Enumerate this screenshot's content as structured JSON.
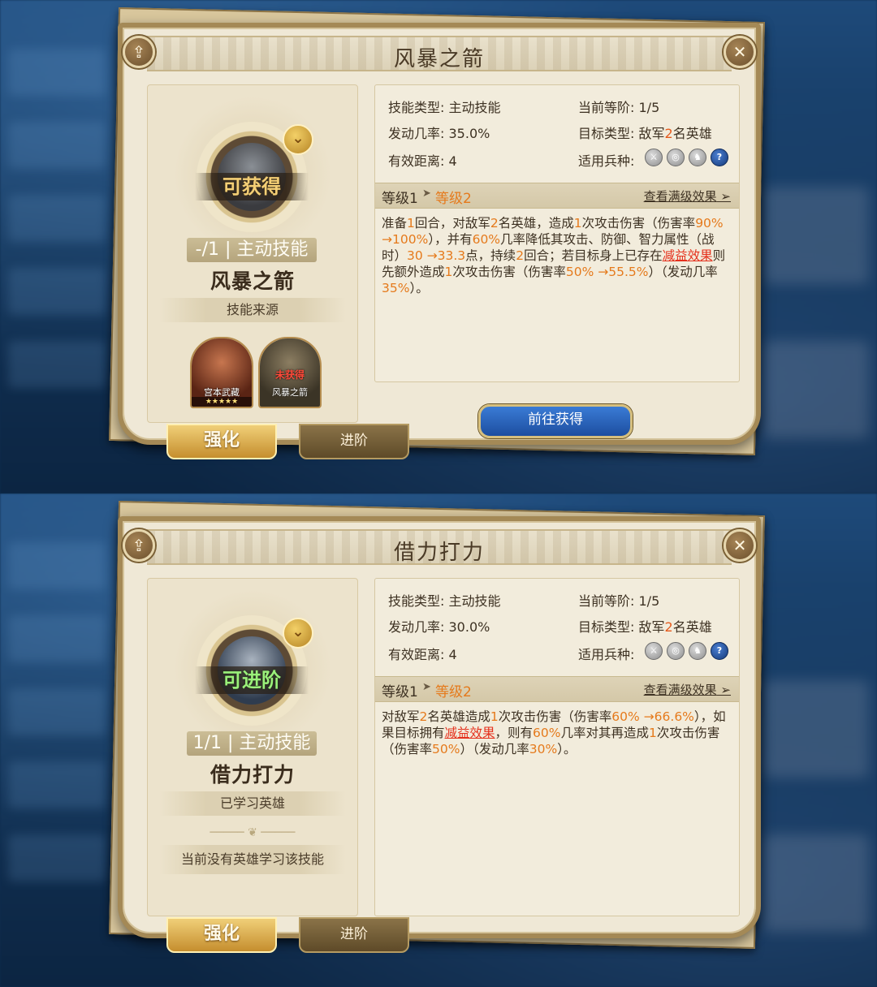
{
  "panels": [
    {
      "title": "风暴之箭",
      "skill_state": "可获得",
      "level_tag": "-/1 | 主动技能",
      "skill_name": "风暴之箭",
      "source_label": "技能来源",
      "heroes": [
        {
          "name": "宫本武藏",
          "stars": "★★★★★",
          "locked": ""
        },
        {
          "name": "风暴之箭",
          "stars": "",
          "locked": "未获得"
        }
      ],
      "stats": {
        "type_label": "技能类型:",
        "type_value": "主动技能",
        "rank_label": "当前等阶:",
        "rank_value": "1/5",
        "rate_label": "发动几率:",
        "rate_value": "35.0%",
        "target_label": "目标类型:",
        "target_pre": "敌军",
        "target_num": "2",
        "target_post": "名英雄",
        "range_label": "有效距离:",
        "range_value": "4",
        "troop_label": "适用兵种:"
      },
      "level_from": "等级1",
      "level_to": "等级2",
      "view_max": "查看满级效果",
      "desc_segments": [
        [
          "t",
          "准备"
        ],
        [
          "o",
          "1"
        ],
        [
          "t",
          "回合，对敌军"
        ],
        [
          "o",
          "2"
        ],
        [
          "t",
          "名英雄，造成"
        ],
        [
          "o",
          "1"
        ],
        [
          "t",
          "次攻击伤害（伤害率"
        ],
        [
          "o",
          "90% →100%"
        ],
        [
          "t",
          "），并有"
        ],
        [
          "o",
          "60%"
        ],
        [
          "t",
          "几率降低其攻击、防御、智力属性（战时）"
        ],
        [
          "o",
          "30 →33.3"
        ],
        [
          "t",
          "点，持续"
        ],
        [
          "o",
          "2"
        ],
        [
          "t",
          "回合；若目标身上已存在"
        ],
        [
          "r",
          "减益效果"
        ],
        [
          "t",
          "则先额外造成"
        ],
        [
          "o",
          "1"
        ],
        [
          "t",
          "次攻击伤害（伤害率"
        ],
        [
          "o",
          "50% →55.5%"
        ],
        [
          "t",
          "）（发动几率"
        ],
        [
          "o",
          "35%"
        ],
        [
          "t",
          "）。"
        ]
      ],
      "go_button": "前往获得",
      "tab_active": "强化",
      "tab_inactive": "进阶"
    },
    {
      "title": "借力打力",
      "skill_state": "可进阶",
      "level_tag": "1/1 | 主动技能",
      "skill_name": "借力打力",
      "source_label": "已学习英雄",
      "no_hero": "当前没有英雄学习该技能",
      "stats": {
        "type_label": "技能类型:",
        "type_value": "主动技能",
        "rank_label": "当前等阶:",
        "rank_value": "1/5",
        "rate_label": "发动几率:",
        "rate_value": "30.0%",
        "target_label": "目标类型:",
        "target_pre": "敌军",
        "target_num": "2",
        "target_post": "名英雄",
        "range_label": "有效距离:",
        "range_value": "4",
        "troop_label": "适用兵种:"
      },
      "level_from": "等级1",
      "level_to": "等级2",
      "view_max": "查看满级效果",
      "desc_segments": [
        [
          "t",
          "对敌军"
        ],
        [
          "o",
          "2"
        ],
        [
          "t",
          "名英雄造成"
        ],
        [
          "o",
          "1"
        ],
        [
          "t",
          "次攻击伤害（伤害率"
        ],
        [
          "o",
          "60% →66.6%"
        ],
        [
          "t",
          "），如果目标拥有"
        ],
        [
          "r",
          "减益效果"
        ],
        [
          "t",
          "，则有"
        ],
        [
          "o",
          "60%"
        ],
        [
          "t",
          "几率对其再造成"
        ],
        [
          "o",
          "1"
        ],
        [
          "t",
          "次攻击伤害（伤害率"
        ],
        [
          "o",
          "50%"
        ],
        [
          "t",
          "）（发动几率"
        ],
        [
          "o",
          "30%"
        ],
        [
          "t",
          "）。"
        ]
      ],
      "tab_active": "强化",
      "tab_inactive": "进阶"
    }
  ],
  "icons": {
    "share": "share-icon",
    "close": "close-icon",
    "chevron": "chevron-down-icon",
    "troops": [
      "sword-icon",
      "bow-icon",
      "horse-icon",
      "help-icon"
    ]
  }
}
